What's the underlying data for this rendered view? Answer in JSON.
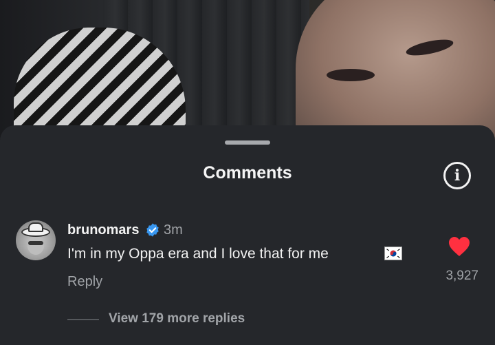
{
  "sheet": {
    "title": "Comments",
    "info_icon": "info-icon"
  },
  "comment": {
    "username": "brunomars",
    "verified_icon": "verified-badge-icon",
    "time": "3m",
    "text": "I'm in my Oppa era and I love that for me",
    "flag_icon": "south-korea-flag-icon",
    "reply_label": "Reply",
    "like_icon": "heart-icon",
    "like_count": "3,927",
    "liked": true,
    "view_replies": "View 179 more replies"
  },
  "colors": {
    "sheet_bg": "#25272b",
    "text_primary": "#f2f2f2",
    "text_secondary": "#a1a4a8",
    "verified_blue": "#3897f0",
    "heart_red": "#ff3040"
  }
}
